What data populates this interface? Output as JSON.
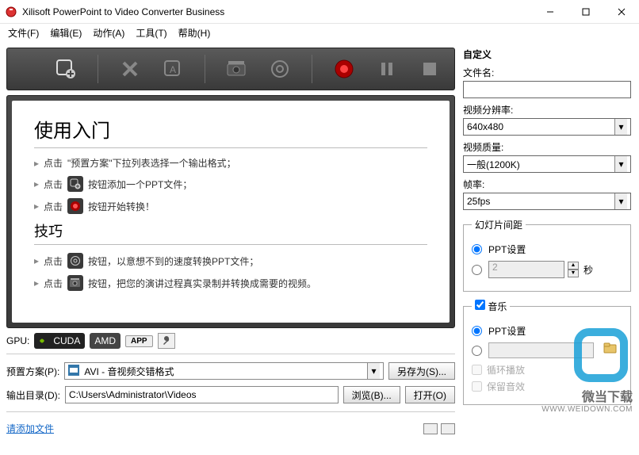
{
  "title": "Xilisoft PowerPoint to Video Converter Business",
  "menu": [
    "文件(F)",
    "编辑(E)",
    "动作(A)",
    "工具(T)",
    "帮助(H)"
  ],
  "guide": {
    "heading1": "使用入门",
    "step1a": "点击",
    "step1b": "\"预置方案\"下拉列表选择一个输出格式；",
    "step2a": "点击",
    "step2b": "按钮添加一个PPT文件；",
    "step3a": "点击",
    "step3b": "按钮开始转换！",
    "heading2": "技巧",
    "tip1a": "点击",
    "tip1b": "按钮，以意想不到的速度转换PPT文件；",
    "tip2a": "点击",
    "tip2b": "按钮，把您的演讲过程真实录制并转换成需要的视频。"
  },
  "gpu": {
    "label": "GPU:",
    "cuda": "CUDA",
    "amd": "AMD",
    "app": "APP"
  },
  "preset": {
    "label": "预置方案(P):",
    "value": "AVI - 音视频交错格式",
    "saveas": "另存为(S)..."
  },
  "output": {
    "label": "输出目录(D):",
    "value": "C:\\Users\\Administrator\\Videos",
    "browse": "浏览(B)...",
    "open": "打开(O)"
  },
  "status": {
    "addfile": "请添加文件"
  },
  "right": {
    "custom": "自定义",
    "filename": "文件名:",
    "filename_value": "",
    "res_label": "视频分辨率:",
    "res_value": "640x480",
    "quality_label": "视频质量:",
    "quality_value": "一般(1200K)",
    "fps_label": "帧率:",
    "fps_value": "25fps",
    "slide_legend": "幻灯片间距",
    "ppt_setting": "PPT设置",
    "seconds_value": "2",
    "seconds_unit": "秒",
    "music_legend": "音乐",
    "loop": "循环播放",
    "keep": "保留音效"
  },
  "watermark": {
    "text": "微当下载",
    "url": "WWW.WEIDOWN.COM"
  }
}
